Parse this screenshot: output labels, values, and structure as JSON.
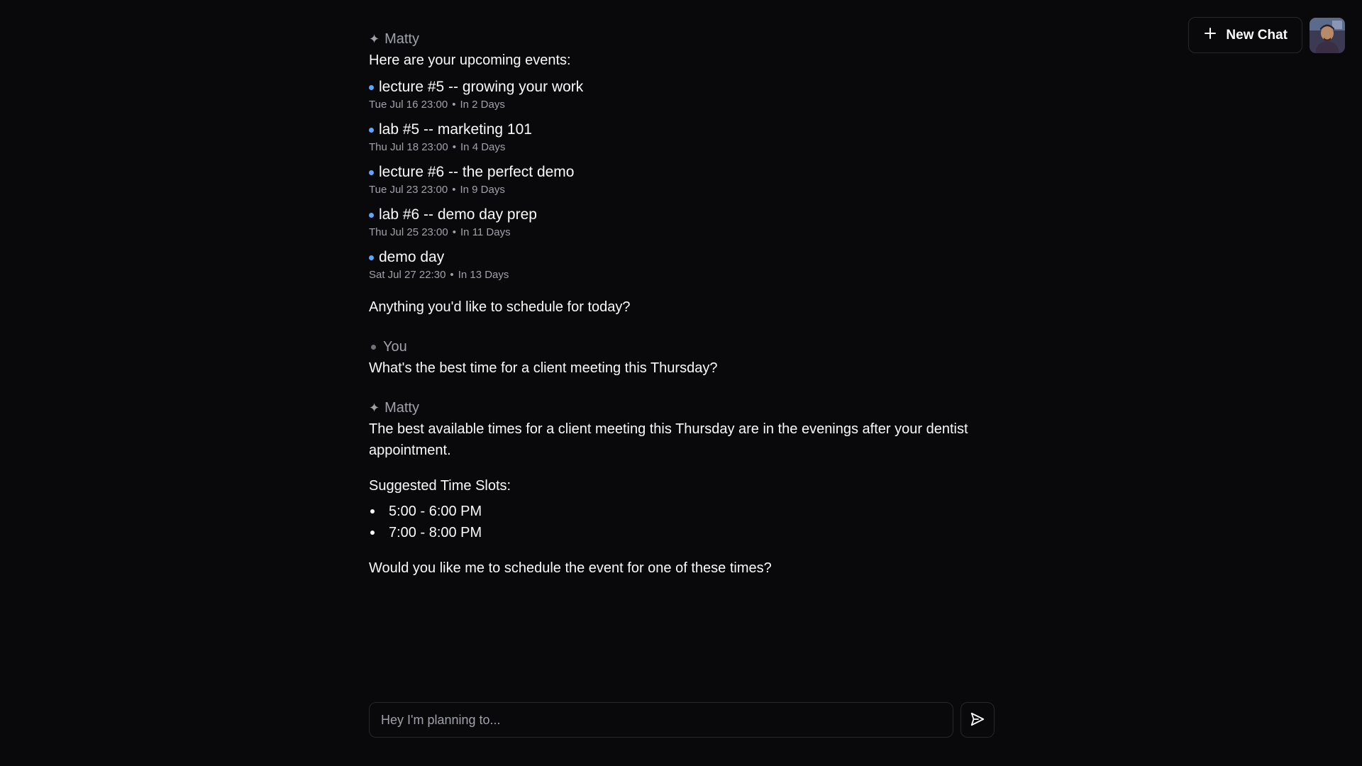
{
  "header": {
    "new_chat_label": "New Chat",
    "icons": {
      "new_chat": "plus-icon",
      "avatar": "user-avatar"
    }
  },
  "messages": [
    {
      "sender": "Matty",
      "sender_mark": "✦",
      "intro": "Here are your upcoming events:",
      "events": [
        {
          "title": "lecture #5 -- growing your work",
          "date": "Tue Jul 16 23:00",
          "sep": "•",
          "relative": "In 2 Days"
        },
        {
          "title": "lab #5 -- marketing 101",
          "date": "Thu Jul 18 23:00",
          "sep": "•",
          "relative": "In 4 Days"
        },
        {
          "title": "lecture #6 -- the perfect demo",
          "date": "Tue Jul 23 23:00",
          "sep": "•",
          "relative": "In 9 Days"
        },
        {
          "title": "lab #6 -- demo day prep",
          "date": "Thu Jul 25 23:00",
          "sep": "•",
          "relative": "In 11 Days"
        },
        {
          "title": "demo day",
          "date": "Sat Jul 27 22:30",
          "sep": "•",
          "relative": "In 13 Days"
        }
      ],
      "outro": "Anything you'd like to schedule for today?"
    },
    {
      "sender": "You",
      "text": "What's the best time for a client meeting this Thursday?"
    },
    {
      "sender": "Matty",
      "sender_mark": "✦",
      "text": "The best available times for a client meeting this Thursday are in the evenings after your dentist appointment.",
      "slots_heading": "Suggested Time Slots:",
      "slots": [
        "5:00 - 6:00 PM",
        "7:00 - 8:00 PM"
      ],
      "closing": "Would you like me to schedule the event for one of these times?"
    }
  ],
  "composer": {
    "placeholder": "Hey I'm planning to...",
    "value": "",
    "send_icon": "send-icon"
  },
  "colors": {
    "background": "#09090b",
    "border": "#27272a",
    "text": "#fafafa",
    "muted": "#a1a1aa",
    "event_bullet": "#60a5fa"
  }
}
